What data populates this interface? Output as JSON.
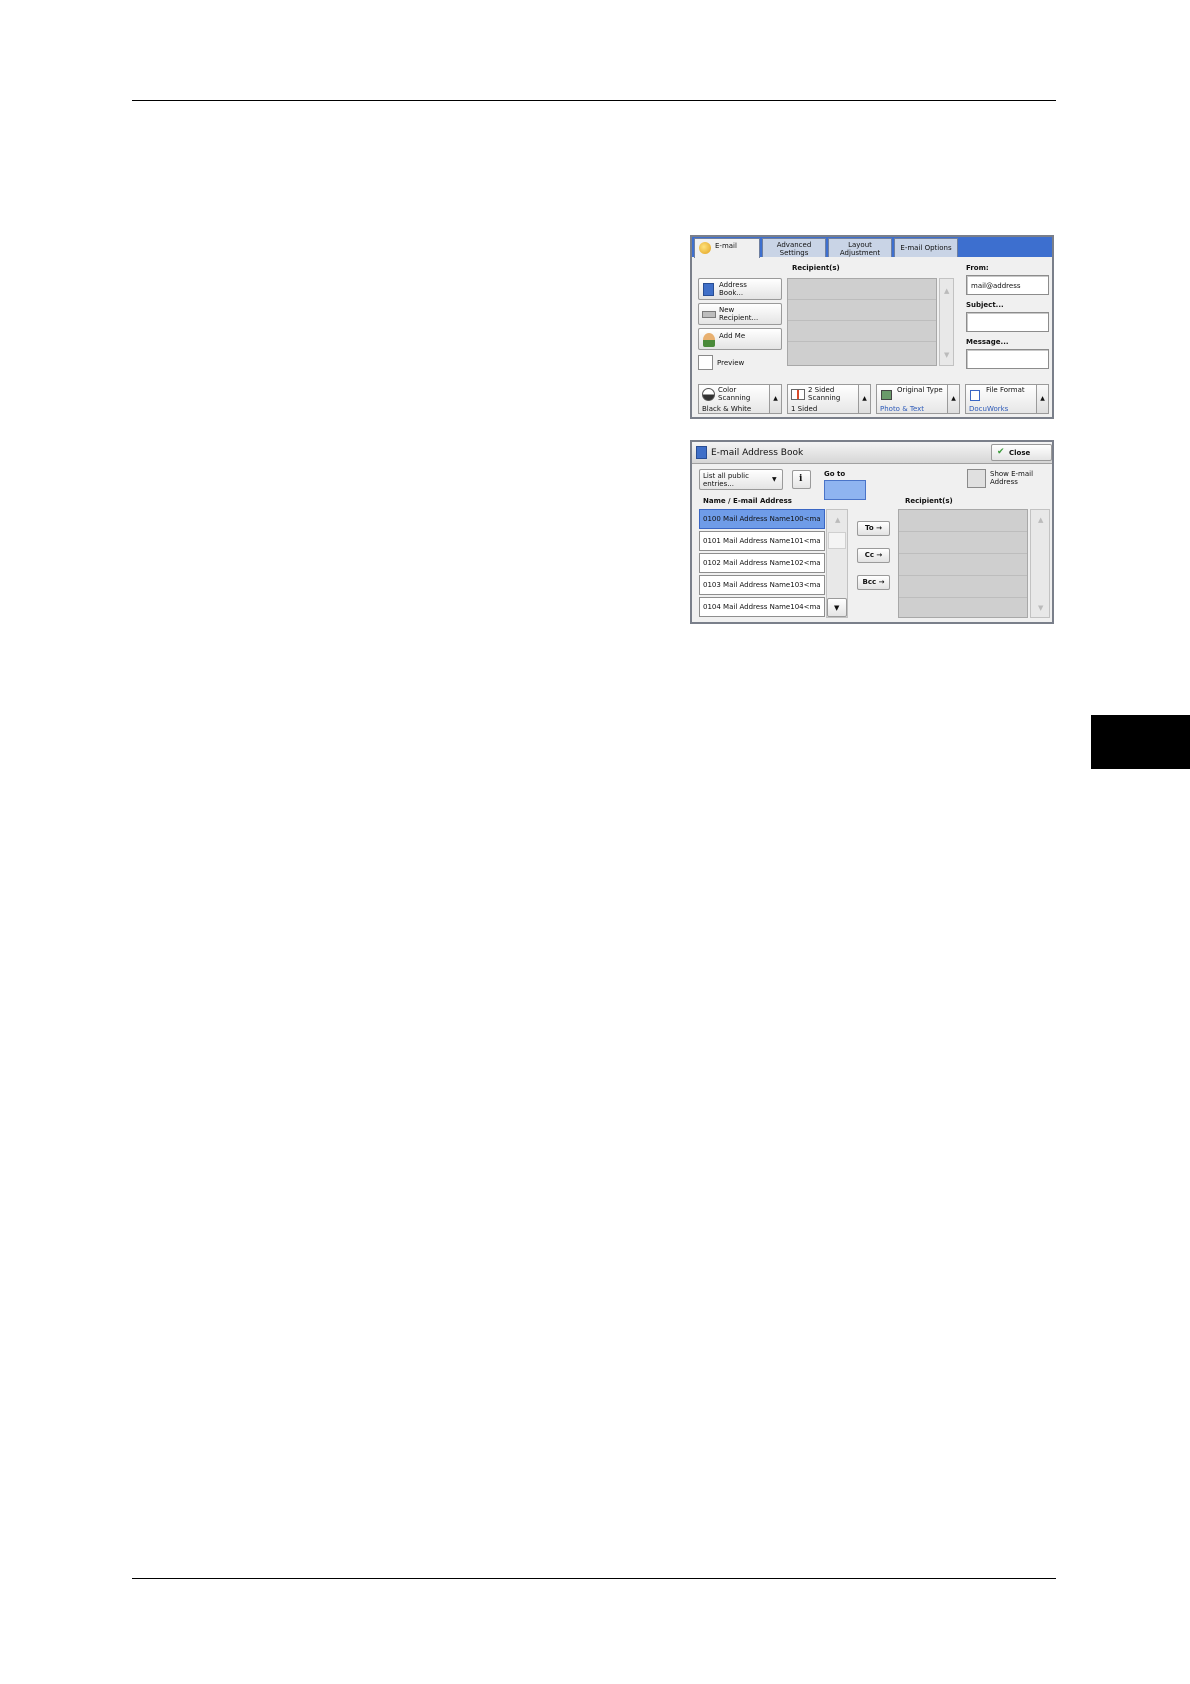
{
  "email_screen": {
    "tabs": [
      "E-mail",
      "Advanced Settings",
      "Layout Adjustment",
      "E-mail Options"
    ],
    "recipients_header": "Recipient(s)",
    "buttons": {
      "address_book": "Address Book...",
      "new_recipient": "New Recipient...",
      "add_me": "Add Me",
      "preview": "Preview"
    },
    "from_label": "From:",
    "from_value": "mail@address",
    "subject_label": "Subject...",
    "message_label": "Message...",
    "features": [
      {
        "label": "Color Scanning",
        "value": "Black & White"
      },
      {
        "label": "2 Sided Scanning",
        "value": "1 Sided"
      },
      {
        "label": "Original Type",
        "value": "Photo & Text"
      },
      {
        "label": "File Format",
        "value": "DocuWorks"
      }
    ]
  },
  "address_book": {
    "title": "E-mail Address Book",
    "close_label": "Close",
    "list_select": "List all public entries...",
    "goto_label": "Go to",
    "show_email_label": "Show E-mail Address",
    "name_header": "Name / E-mail Address",
    "recipients_header": "Recipient(s)",
    "entries": [
      "0100  Mail Address Name100<ma",
      "0101  Mail Address Name101<ma",
      "0102  Mail Address Name102<ma",
      "0103  Mail Address Name103<ma",
      "0104  Mail Address Name104<ma"
    ],
    "to_label": "To →",
    "cc_label": "Cc →",
    "bcc_label": "Bcc →"
  },
  "colors": {
    "tab_bar": "#3d6fcf",
    "selected_entry": "#6f9ce8",
    "side_tab": "#000000"
  }
}
